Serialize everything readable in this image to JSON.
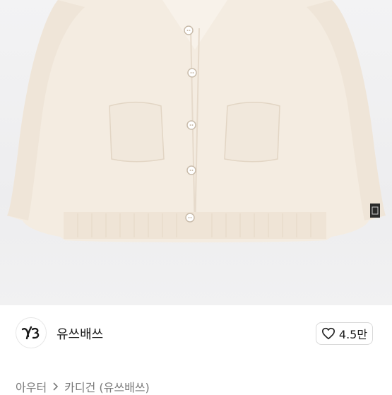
{
  "product": {
    "image_alt": "cream knit cardigan"
  },
  "brand": {
    "name": "유쓰배쓰",
    "logo_icon": "yb-logo-icon"
  },
  "like": {
    "icon": "heart-icon",
    "count": "4.5만"
  },
  "breadcrumb": {
    "items": [
      "아우터",
      "카디건 (유쓰배쓰)"
    ],
    "separator_icon": "chevron-right-icon"
  }
}
